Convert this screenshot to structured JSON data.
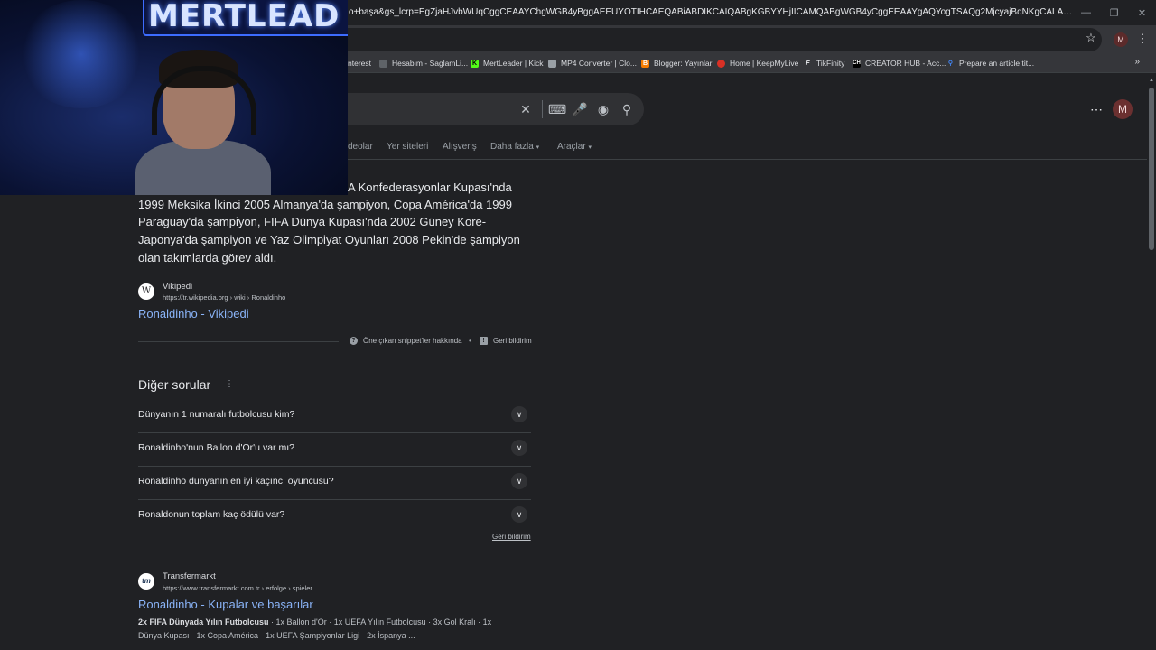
{
  "browser": {
    "url": "o+başa&gs_lcrp=EgZjaHJvbWUqCggCEAAYChgWGB4yBggAEEUYOTIHCAEQABiABDIKCAIQABgKGBYYHjIICAMQABgWGB4yCggEEAAYgAQYogTSAQg2MjcyajBqNKgCALACAA&sourceid=chrome&i...",
    "profile_initial": "M",
    "bookmarks": [
      {
        "label": "nterest",
        "color": "#35363a"
      },
      {
        "label": "Hesabım - SaglamLi...",
        "color": "#5f6368"
      },
      {
        "label": "MertLeader | Kick",
        "color": "#53fc18"
      },
      {
        "label": "MP4 Converter | Clo...",
        "color": "#9aa0a6"
      },
      {
        "label": "Blogger: Yayınlar",
        "color": "#f57c00"
      },
      {
        "label": "Home | KeepMyLive",
        "color": "#d93025"
      },
      {
        "label": "TikFinity",
        "color": "#e8eaed"
      },
      {
        "label": "CREATOR HUB - Acc...",
        "color": "#202124"
      },
      {
        "label": "Prepare an article tit...",
        "color": "#4285f4"
      }
    ]
  },
  "webcam": {
    "banner": "MERTLEAD"
  },
  "google": {
    "avatar_initial": "M",
    "tabs": [
      "deolar",
      "Yer siteleri",
      "Alışveriş",
      "Daha fazla",
      "Araçlar"
    ]
  },
  "snippet": {
    "lines": [
      "A Konfederasyonlar Kupası'nda",
      "1999 Meksika İkinci 2005 Almanya'da şampiyon, Copa América'da 1999",
      "Paraguay'da şampiyon, FIFA Dünya Kupası'nda 2002 Güney Kore-",
      "Japonya'da şampiyon ve Yaz Olimpiyat Oyunları 2008 Pekin'de şampiyon",
      "olan takımlarda görev aldı."
    ],
    "source_icon": "W",
    "source_name": "Vikipedi",
    "source_url": "https://tr.wikipedia.org › wiki › Ronaldinho",
    "title": "Ronaldinho - Vikipedi",
    "about": "Öne çıkan snippet'ler hakkında",
    "feedback": "Geri bildirim"
  },
  "paa": {
    "title": "Diğer sorular",
    "questions": [
      "Dünyanın 1 numaralı futbolcusu kim?",
      "Ronaldinho'nun Ballon d'Or'u var mı?",
      "Ronaldinho dünyanın en iyi kaçıncı oyuncusu?",
      "Ronaldonun toplam kaç ödülü var?"
    ],
    "feedback": "Geri bildirim"
  },
  "result2": {
    "icon": "tm",
    "site": "Transfermarkt",
    "url": "https://www.transfermarkt.com.tr › erfolge › spieler",
    "title": "Ronaldinho - Kupalar ve başarılar",
    "desc_bold": "2x FIFA Dünyada Yılın Futbolcusu",
    "desc_line1": " · 1x Ballon d'Or · 1x UEFA Yılın Futbolcusu · 3x Gol Kralı · 1x",
    "desc_line2": "Dünya Kupası · 1x Copa América · 1x UEFA Şampiyonlar Ligi · 2x İspanya ..."
  }
}
